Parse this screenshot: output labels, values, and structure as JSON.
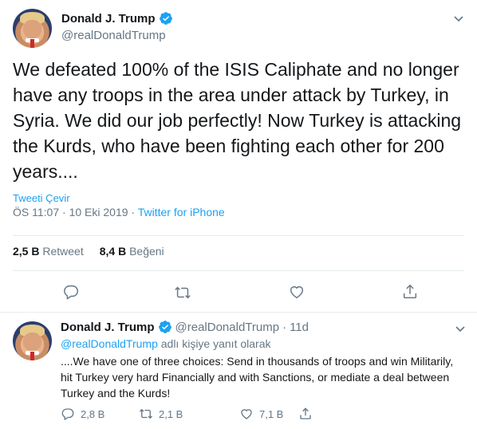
{
  "main_tweet": {
    "display_name": "Donald J. Trump",
    "handle": "@realDonaldTrump",
    "text": "We defeated 100% of the ISIS Caliphate and no longer have any troops in the area under attack by Turkey, in Syria. We did our job perfectly! Now Turkey is attacking the Kurds, who have been fighting each other for 200 years....",
    "translate_label": "Tweeti Çevir",
    "time": "ÖS 11:07",
    "date": "10 Eki 2019",
    "separator": "·",
    "source": "Twitter for iPhone",
    "retweet_count": "2,5 B",
    "retweet_label": "Retweet",
    "like_count": "8,4 B",
    "like_label": "Beğeni"
  },
  "reply_tweet": {
    "display_name": "Donald J. Trump",
    "handle": "@realDonaldTrump",
    "separator": "·",
    "age": "11d",
    "reply_to_mention": "@realDonaldTrump",
    "reply_to_suffix": "adlı kişiye yanıt olarak",
    "text": "....We have one of three choices: Send in thousands of troops and win Militarily, hit Turkey very hard Financially and with Sanctions, or mediate a deal between Turkey and the Kurds!",
    "reply_count": "2,8 B",
    "retweet_count": "2,1 B",
    "like_count": "7,1 B"
  },
  "colors": {
    "accent": "#1da1f2",
    "secondary_text": "#657786",
    "primary_text": "#14171a",
    "divider": "#e6ecf0"
  },
  "icons": [
    "verified-badge-icon",
    "chevron-down-icon",
    "reply-icon",
    "retweet-icon",
    "like-icon",
    "share-icon"
  ]
}
